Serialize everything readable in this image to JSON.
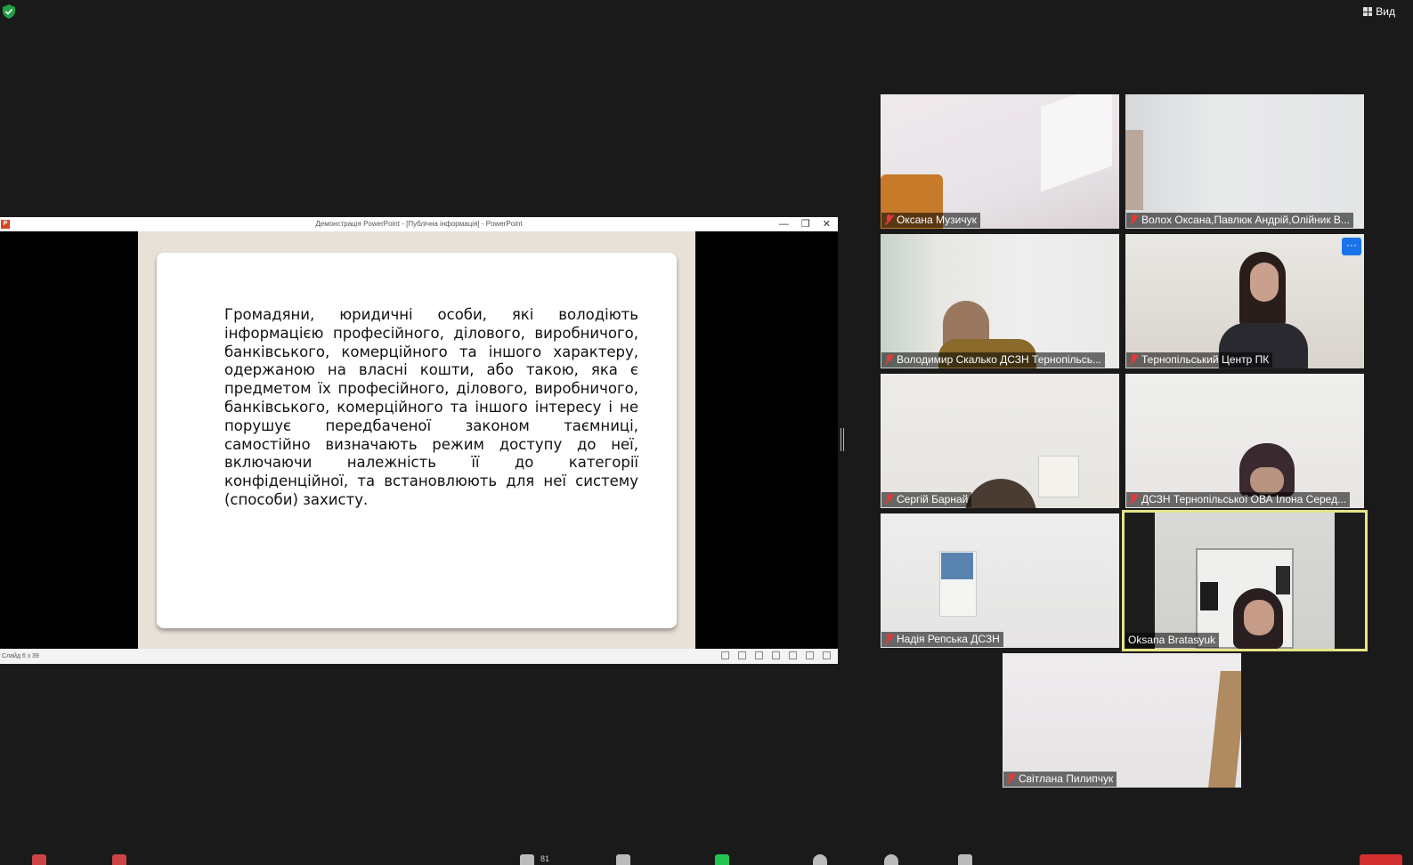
{
  "top": {
    "view_label": "Вид"
  },
  "powerpoint": {
    "window_title": "Демонстрація PowerPoint - [Публічна інформація] - PowerPoint",
    "logo": "P",
    "slide_text": "Громадяни, юридичні особи, які володіють інформацією професійного, ділового, виробничого, банківського, комерційного та іншого характеру, одержаною на власні кошти, або такою, яка є предметом їх професійного, ділового, виробничого, банківського, комерційного та іншого інтересу і не порушує передбаченої законом таємниці, самостійно визначають режим доступу до неї, включаючи належність її до категорії конфіденційної, та встановлюють для неї систему (способи) захисту.",
    "status": "Слайд 6 з 39",
    "controls": [
      "—",
      "❐",
      "✕"
    ]
  },
  "participants": [
    {
      "name": "Оксана Музичук",
      "muted": true
    },
    {
      "name": "Волох Оксана,Павлюк Андрій,Олійник В...",
      "muted": true
    },
    {
      "name": "Володимир Скалько ДСЗН Тернопільсь...",
      "muted": true
    },
    {
      "name": "Тернопільський Центр ПК",
      "muted": true,
      "more": "···"
    },
    {
      "name": "Сергій Барнай",
      "muted": true
    },
    {
      "name": "ДСЗН Тернопільської ОВА Ілона Серед...",
      "muted": true
    },
    {
      "name": "Надія Репська ДСЗН",
      "muted": true
    },
    {
      "name": "Oksana Bratasyuk",
      "muted": false,
      "speaking": true
    },
    {
      "name": "Світлана Пилипчук",
      "muted": true
    }
  ],
  "toolbar": {
    "participants_count": "81"
  },
  "colors": {
    "background": "#1a1a1a",
    "speaker_border": "#e6e48a",
    "muted_red": "#e23a3a",
    "zoom_blue": "#1a73e8"
  }
}
